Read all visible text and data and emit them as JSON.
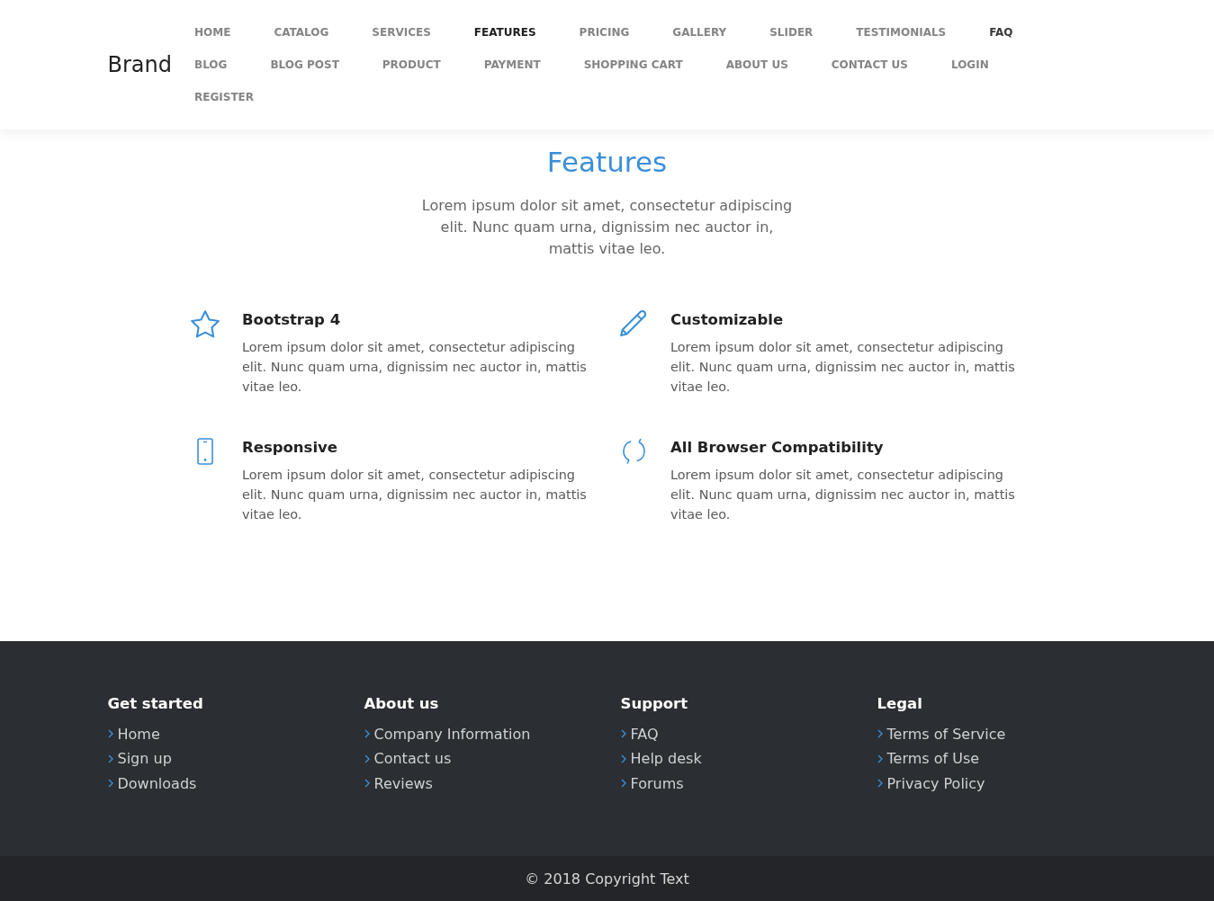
{
  "header": {
    "brand": "Brand",
    "nav": [
      {
        "label": "HOME",
        "selected": false,
        "hovered": false
      },
      {
        "label": "CATALOG",
        "selected": false,
        "hovered": false
      },
      {
        "label": "SERVICES",
        "selected": false,
        "hovered": false
      },
      {
        "label": "FEATURES",
        "selected": true,
        "hovered": false
      },
      {
        "label": "PRICING",
        "selected": false,
        "hovered": false
      },
      {
        "label": "GALLERY",
        "selected": false,
        "hovered": false
      },
      {
        "label": "SLIDER",
        "selected": false,
        "hovered": false
      },
      {
        "label": "TESTIMONIALS",
        "selected": false,
        "hovered": false
      },
      {
        "label": "FAQ",
        "selected": false,
        "hovered": true
      },
      {
        "label": "BLOG",
        "selected": false,
        "hovered": false
      },
      {
        "label": "BLOG POST",
        "selected": false,
        "hovered": false
      },
      {
        "label": "PRODUCT",
        "selected": false,
        "hovered": false
      },
      {
        "label": "PAYMENT",
        "selected": false,
        "hovered": false
      },
      {
        "label": "SHOPPING CART",
        "selected": false,
        "hovered": false
      },
      {
        "label": "ABOUT US",
        "selected": false,
        "hovered": false
      },
      {
        "label": "CONTACT US",
        "selected": false,
        "hovered": false
      },
      {
        "label": "LOGIN",
        "selected": false,
        "hovered": false
      },
      {
        "label": "REGISTER",
        "selected": false,
        "hovered": false
      }
    ]
  },
  "intro": {
    "title": "Features",
    "text": "Lorem ipsum dolor sit amet, consectetur adipiscing elit. Nunc quam urna, dignissim nec auctor in, mattis vitae leo."
  },
  "features": [
    {
      "title": "Bootstrap 4",
      "text": "Lorem ipsum dolor sit amet, consectetur adipiscing elit. Nunc quam urna, dignissim nec auctor in, mattis vitae leo."
    },
    {
      "title": "Customizable",
      "text": "Lorem ipsum dolor sit amet, consectetur adipiscing elit. Nunc quam urna, dignissim nec auctor in, mattis vitae leo."
    },
    {
      "title": "Responsive",
      "text": "Lorem ipsum dolor sit amet, consectetur adipiscing elit. Nunc quam urna, dignissim nec auctor in, mattis vitae leo."
    },
    {
      "title": "All Browser Compatibility",
      "text": "Lorem ipsum dolor sit amet, consectetur adipiscing elit. Nunc quam urna, dignissim nec auctor in, mattis vitae leo."
    }
  ],
  "footer": {
    "columns": [
      {
        "title": "Get started",
        "links": [
          "Home",
          "Sign up",
          "Downloads"
        ]
      },
      {
        "title": "About us",
        "links": [
          "Company Information",
          "Contact us",
          "Reviews"
        ]
      },
      {
        "title": "Support",
        "links": [
          "FAQ",
          "Help desk",
          "Forums"
        ]
      },
      {
        "title": "Legal",
        "links": [
          "Terms of Service",
          "Terms of Use",
          "Privacy Policy"
        ]
      }
    ],
    "copyright": "© 2018 Copyright Text"
  }
}
